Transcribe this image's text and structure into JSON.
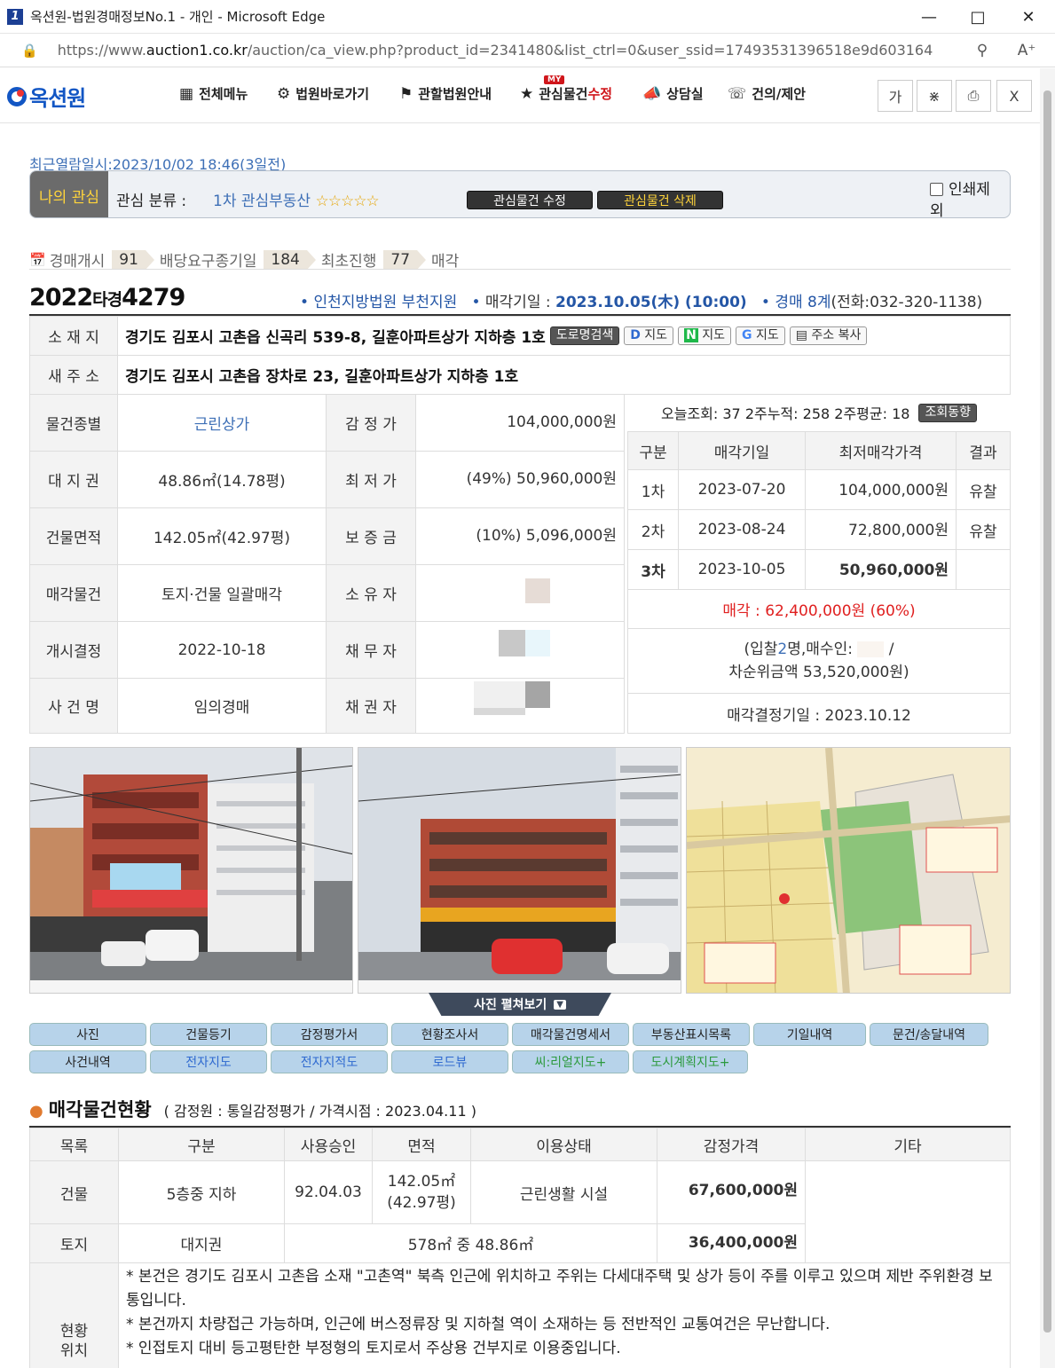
{
  "window": {
    "title": "옥션원-법원경매정보No.1 - 개인 - Microsoft Edge",
    "favicon": "1"
  },
  "browser": {
    "url_prefix": "https://www.",
    "url_domain": "auction1.co.kr",
    "url_rest": "/auction/ca_view.php?product_id=2341480&list_ctrl=0&user_ssid=17493531396518e9d603164"
  },
  "header": {
    "logo": "옥션원",
    "nav": [
      {
        "label": "전체메뉴",
        "icon": "grid-icon"
      },
      {
        "label": "법원바로가기",
        "icon": "court-icon"
      },
      {
        "label": "관할법원안내",
        "icon": "map-marker-icon"
      },
      {
        "label": "관심물건",
        "label_red": "수정",
        "icon": "star-folder-icon",
        "badge": "MY"
      },
      {
        "label": "상담실",
        "icon": "megaphone-icon"
      },
      {
        "label": "건의/제안",
        "icon": "headset-icon"
      }
    ],
    "tools": [
      "가",
      "share",
      "print",
      "X"
    ]
  },
  "recent": "최근열람일시:2023/10/02 18:46(3일전)",
  "interest": {
    "label": "나의 관심",
    "category_label": "관심 분류 :",
    "category_value": "1차 관심부동산",
    "stars": "☆☆☆☆☆",
    "edit_btn": "관심물건 수정",
    "delete_btn": "관심물건 삭제",
    "print_exclude": "인쇄제외"
  },
  "steps": [
    {
      "label": "경매개시",
      "num": "91"
    },
    {
      "label": "배당요구종기일",
      "num": "184"
    },
    {
      "label": "최초진행",
      "num": "77"
    },
    {
      "label": "매각",
      "num": ""
    }
  ],
  "case": {
    "year": "2022",
    "kind": "타경",
    "no": "4279",
    "court": "인천지방법원 부천지원",
    "date_label": "매각기일 :",
    "date": "2023.10.05(木) (10:00)",
    "dept": "경매 8계",
    "phone": "(전화:032-320-1138)"
  },
  "address": {
    "label": "소 재 지",
    "value": "경기도 김포시 고촌읍 신곡리 539-8, 길훈아파트상가 지하층 1호",
    "buttons": [
      "도로명검색",
      "지도",
      "지도",
      "지도",
      "주소 복사"
    ],
    "new_label": "새 주 소",
    "new_value": "경기도 김포시 고촌읍 장차로 23, 길훈아파트상가 지하층 1호"
  },
  "details": [
    {
      "label": "물건종별",
      "value": "근린상가",
      "label2": "감 정 가",
      "value2": "104,000,000원"
    },
    {
      "label": "대 지 권",
      "value": "48.86㎡(14.78평)",
      "label2": "최 저 가",
      "value2": "(49%) 50,960,000원"
    },
    {
      "label": "건물면적",
      "value": "142.05㎡(42.97평)",
      "label2": "보 증 금",
      "value2": "(10%) 5,096,000원"
    },
    {
      "label": "매각물건",
      "value": "토지·건물 일괄매각",
      "label2": "소 유 자",
      "value2": ""
    },
    {
      "label": "개시결정",
      "value": "2022-10-18",
      "label2": "채 무 자",
      "value2": ""
    },
    {
      "label": "사 건 명",
      "value": "임의경매",
      "label2": "채 권 자",
      "value2": ""
    }
  ],
  "views": {
    "text": "오늘조회: 37  2주누적: 258  2주평균: 18",
    "btn": "조회동향"
  },
  "rounds": {
    "headers": [
      "구분",
      "매각기일",
      "최저매각가격",
      "결과"
    ],
    "rows": [
      {
        "round": "1차",
        "date": "2023-07-20",
        "price": "104,000,000원",
        "result": "유찰"
      },
      {
        "round": "2차",
        "date": "2023-08-24",
        "price": "72,800,000원",
        "result": "유찰"
      },
      {
        "round": "3차",
        "date": "2023-10-05",
        "price": "50,960,000원",
        "result": ""
      }
    ],
    "sold": "매각 : 62,400,000원 (60%)",
    "bid_line1_a": "(입찰",
    "bid_count": "2",
    "bid_line1_b": "명,매수인:",
    "bid_line1_c": "/",
    "bid_line2": "차순위금액 53,520,000원)",
    "decision": "매각결정기일 : 2023.10.12"
  },
  "photo_caption": "사진 펼쳐보기",
  "tabs_row1": [
    "사진",
    "건물등기",
    "감정평가서",
    "현황조사서",
    "매각물건명세서",
    "부동산표시목록",
    "기일내역",
    "문건/송달내역"
  ],
  "tabs_row2": [
    "사건내역",
    "전자지도",
    "전자지적도",
    "로드뷰",
    "씨:리얼지도+",
    "도시계획지도+"
  ],
  "section": {
    "title": "매각물건현황",
    "sub": "( 감정원 : 통일감정평가 / 가격시점 : 2023.04.11 )"
  },
  "status_table": {
    "headers": [
      "목록",
      "구분",
      "사용승인",
      "면적",
      "이용상태",
      "감정가격",
      "기타"
    ],
    "building": {
      "label": "건물",
      "kind": "5층중 지하",
      "approval": "92.04.03",
      "area1": "142.05㎡",
      "area2": "(42.97평)",
      "usage": "근린생활 시설",
      "price": "67,600,000원"
    },
    "land": {
      "label": "토지",
      "kind": "대지권",
      "area": "578㎡ 중 48.86㎡",
      "price": "36,400,000원"
    },
    "location_label1": "현황",
    "location_label2": "위치",
    "notes": [
      "* 본건은 경기도 김포시 고촌읍 소재 \"고촌역\" 북측 인근에 위치하고 주위는 다세대주택 및 상가 등이 주를 이루고 있으며 제반 주위환경 보통입니다.",
      "* 본건까지 차량접근 가능하며, 인근에 버스정류장 및 지하철 역이 소재하는 등 전반적인 교통여건은 무난합니다.",
      "* 인접토지 대비 등고평탄한 부정형의 토지로서 주상용 건부지로 이용중입니다."
    ]
  }
}
